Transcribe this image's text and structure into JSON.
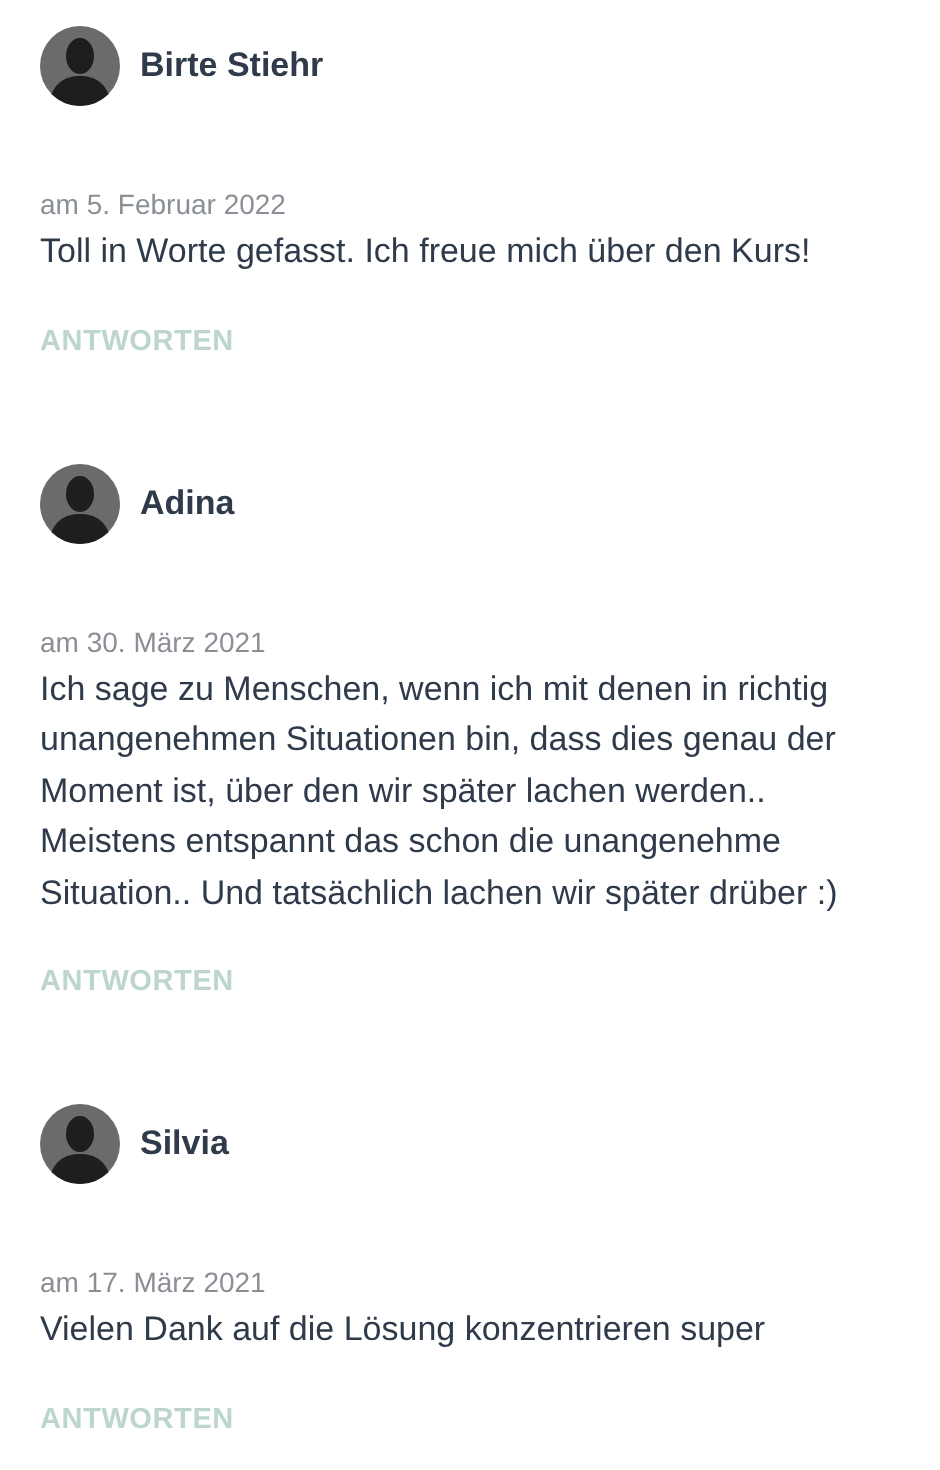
{
  "comments": [
    {
      "author": "Birte Stiehr",
      "date": "am 5. Februar 2022",
      "text": "Toll in Worte gefasst. Ich freue mich über den Kurs!",
      "reply": "ANTWORTEN"
    },
    {
      "author": "Adina",
      "date": "am 30. März 2021",
      "text": "Ich sage zu Menschen, wenn ich mit denen in richtig unangenehmen Situationen bin, dass dies genau der Moment ist, über den wir später lachen werden.. Meistens entspannt das schon die unangenehme Situation.. Und tatsächlich lachen wir später drüber :)",
      "reply": "ANTWORTEN"
    },
    {
      "author": "Silvia",
      "date": "am 17. März 2021",
      "text": "Vielen Dank auf die Lösung konzentrieren super",
      "reply": "ANTWORTEN"
    }
  ]
}
